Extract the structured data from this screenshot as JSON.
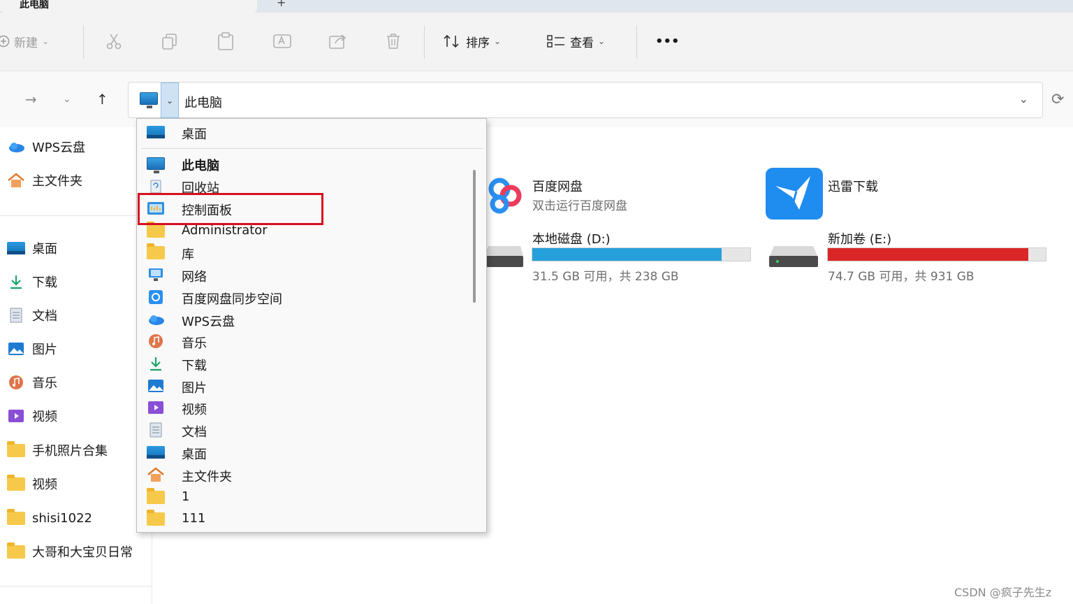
{
  "window": {
    "tab_title": "此电脑",
    "new_tab": "+"
  },
  "toolbar": {
    "new_label": "新建",
    "sort_label": "排序",
    "view_label": "查看",
    "more_label": "•••"
  },
  "address": {
    "path": "此电脑"
  },
  "sidebar": {
    "pinned": [
      {
        "label": "WPS云盘",
        "icon": "cloud-icon"
      },
      {
        "label": "主文件夹",
        "icon": "home-icon"
      }
    ],
    "quick": [
      {
        "label": "桌面",
        "icon": "desktop-icon"
      },
      {
        "label": "下载",
        "icon": "download-icon"
      },
      {
        "label": "文档",
        "icon": "document-icon"
      },
      {
        "label": "图片",
        "icon": "pictures-icon"
      },
      {
        "label": "音乐",
        "icon": "music-icon"
      },
      {
        "label": "视频",
        "icon": "video-icon"
      },
      {
        "label": "手机照片合集",
        "icon": "folder-icon"
      },
      {
        "label": "视频",
        "icon": "folder-icon"
      },
      {
        "label": "shisi1022",
        "icon": "folder-icon"
      },
      {
        "label": "大哥和大宝贝日常",
        "icon": "folder-icon"
      }
    ]
  },
  "content": {
    "apps": [
      {
        "title": "百度网盘",
        "subtitle": "双击运行百度网盘",
        "icon": "baidu-netdisk-icon"
      },
      {
        "title": "迅雷下载",
        "subtitle": "",
        "icon": "xunlei-icon"
      }
    ],
    "drives": [
      {
        "title": "本地磁盘 (D:)",
        "status": "31.5 GB 可用，共 238 GB",
        "used_fraction": 0.868,
        "color": "#26a0da"
      },
      {
        "title": "新加卷 (E:)",
        "status": "74.7 GB 可用，共 931 GB",
        "used_fraction": 0.92,
        "color": "#da2626"
      }
    ]
  },
  "dropdown": {
    "items": [
      {
        "label": "桌面",
        "icon": "desktop-icon"
      },
      {
        "label": "此电脑",
        "icon": "this-pc-icon",
        "bold": true
      },
      {
        "label": "回收站",
        "icon": "recycle-bin-icon"
      },
      {
        "label": "控制面板",
        "icon": "control-panel-icon",
        "highlighted": true
      },
      {
        "label": "Administrator",
        "icon": "user-folder-icon"
      },
      {
        "label": "库",
        "icon": "library-folder-icon"
      },
      {
        "label": "网络",
        "icon": "network-icon"
      },
      {
        "label": "百度网盘同步空间",
        "icon": "baidu-sync-icon"
      },
      {
        "label": "WPS云盘",
        "icon": "cloud-icon"
      },
      {
        "label": "音乐",
        "icon": "music-icon"
      },
      {
        "label": "下载",
        "icon": "download-icon"
      },
      {
        "label": "图片",
        "icon": "pictures-icon"
      },
      {
        "label": "视频",
        "icon": "video-icon"
      },
      {
        "label": "文档",
        "icon": "document-icon"
      },
      {
        "label": "桌面",
        "icon": "desktop-icon"
      },
      {
        "label": "主文件夹",
        "icon": "home-icon"
      },
      {
        "label": "1",
        "icon": "folder-icon"
      },
      {
        "label": "111",
        "icon": "folder-icon"
      }
    ]
  },
  "watermark": "CSDN @疯子先生z"
}
